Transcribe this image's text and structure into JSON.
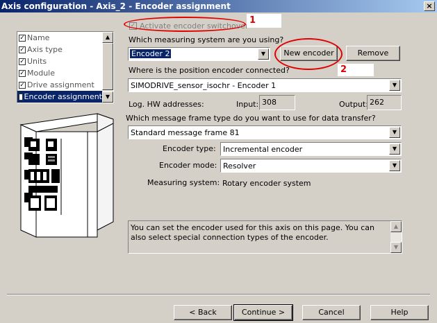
{
  "window": {
    "title": "Axis configuration - Axis_2 - Encoder assignment",
    "close_glyph": "×"
  },
  "nav": {
    "items": [
      {
        "label": "Name",
        "checked": true
      },
      {
        "label": "Axis type",
        "checked": true
      },
      {
        "label": "Units",
        "checked": true
      },
      {
        "label": "Module",
        "checked": true
      },
      {
        "label": "Drive assignment",
        "checked": true
      },
      {
        "label": "Encoder assignment",
        "checked": false,
        "active": true
      }
    ]
  },
  "form": {
    "activate_switchover": {
      "label": "Activate encoder switchover",
      "checked": true
    },
    "measuring_system_question": "Which measuring system are you using?",
    "encoder_select": "Encoder 2",
    "new_encoder_button": "New encoder",
    "remove_button": "Remove",
    "connection_question": "Where is the position encoder connected?",
    "connection_select": "SIMODRIVE_sensor_isochr - Encoder 1",
    "log_hw_label": "Log. HW addresses:",
    "input_label": "Input:",
    "input_value": "308",
    "output_label": "Output:",
    "output_value": "262",
    "frame_question": "Which message frame type do you want to use for data transfer?",
    "frame_select": "Standard message frame 81",
    "encoder_type_label": "Encoder type:",
    "encoder_type_value": "Incremental encoder",
    "encoder_mode_label": "Encoder mode:",
    "encoder_mode_value": "Resolver",
    "measuring_system_label": "Measuring system:",
    "measuring_system_value": "Rotary encoder system",
    "help_text": "You can set the encoder used for this axis on this page. You can also select special connection types of the encoder."
  },
  "annotations": {
    "marker1": "1",
    "marker2": "2",
    "accent": "#e00000"
  },
  "footer": {
    "back_button": "< Back",
    "continue_button": "Continue >",
    "cancel_button": "Cancel",
    "help_button": "Help"
  },
  "icons": [
    "checkbox-checked-icon",
    "scroll-up-icon",
    "scroll-down-icon",
    "dropdown-arrow-icon",
    "drive-module-image"
  ]
}
